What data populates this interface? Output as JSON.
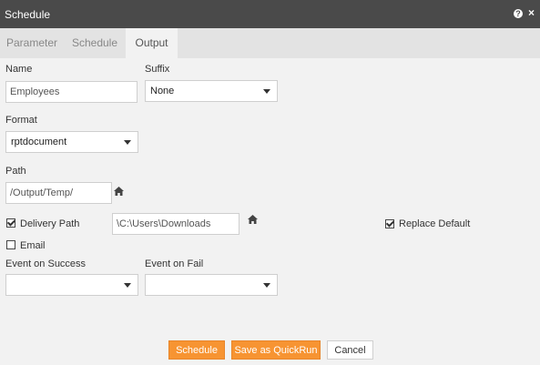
{
  "window": {
    "title": "Schedule",
    "help_icon": "help-icon",
    "close_icon": "close-icon"
  },
  "tabs": [
    {
      "label": "Parameter",
      "active": false
    },
    {
      "label": "Schedule",
      "active": false
    },
    {
      "label": "Output",
      "active": true
    }
  ],
  "form": {
    "name_label": "Name",
    "name_value": "Employees",
    "suffix_label": "Suffix",
    "suffix_value": "None",
    "format_label": "Format",
    "format_value": "rptdocument",
    "path_label": "Path",
    "path_value": "/Output/Temp/",
    "delivery_path_label": "Delivery Path",
    "delivery_path_checked": true,
    "delivery_path_value": "\\C:\\Users\\Downloads",
    "replace_default_label": "Replace Default",
    "replace_default_checked": true,
    "email_label": "Email",
    "email_checked": false,
    "event_success_label": "Event on Success",
    "event_success_value": "",
    "event_fail_label": "Event on Fail",
    "event_fail_value": ""
  },
  "buttons": {
    "schedule": "Schedule",
    "save_quickrun": "Save as QuickRun",
    "cancel": "Cancel"
  },
  "colors": {
    "titlebar": "#4a4a4a",
    "accent": "#f79432",
    "background": "#f2f2f2"
  }
}
